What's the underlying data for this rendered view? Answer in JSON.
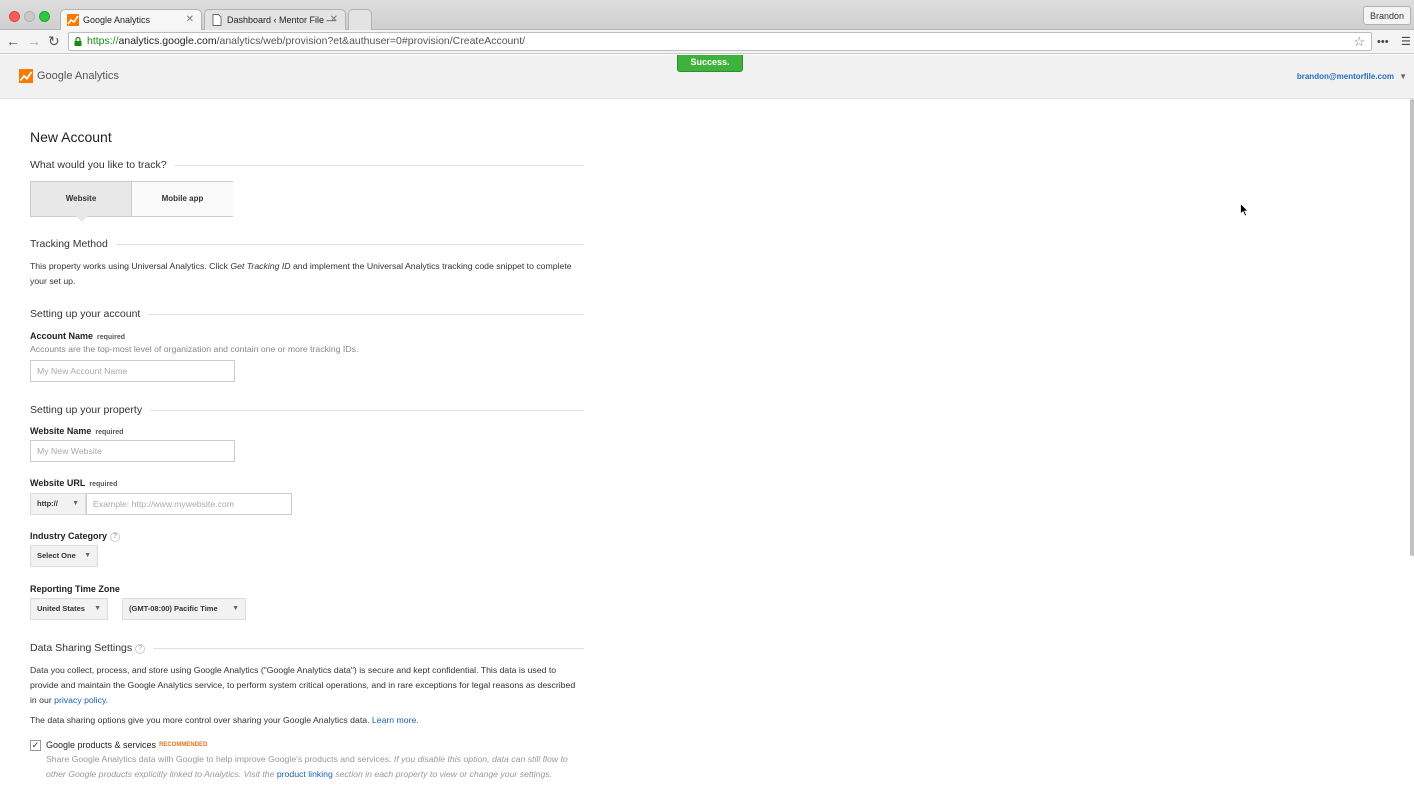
{
  "browser": {
    "tabs": [
      {
        "title": "Google Analytics",
        "active": true
      },
      {
        "title": "Dashboard ‹ Mentor File —",
        "active": false
      }
    ],
    "profile": "Brandon",
    "url_scheme": "https://",
    "url_host": "analytics.google.com",
    "url_path": "/analytics/web/provision?et&authuser=0#provision/CreateAccount/"
  },
  "header": {
    "app_name": "Google Analytics",
    "success_message": "Success.",
    "user_email": "brandon@mentorfile.com"
  },
  "form": {
    "title": "New Account",
    "track_question": "What would you like to track?",
    "track_options": [
      "Website",
      "Mobile app"
    ],
    "tracking_method": {
      "title": "Tracking Method",
      "text_before": "This property works using Universal Analytics. Click ",
      "text_emph": "Get Tracking ID",
      "text_after": " and implement the Universal Analytics tracking code snippet to complete your set up."
    },
    "account_section": "Setting up your account",
    "account_name_label": "Account Name",
    "required": "required",
    "account_name_desc": "Accounts are the top-most level of organization and contain one or more tracking IDs.",
    "account_name_placeholder": "My New Account Name",
    "property_section": "Setting up your property",
    "website_name_label": "Website Name",
    "website_name_placeholder": "My New Website",
    "website_url_label": "Website URL",
    "protocol_value": "http://",
    "website_url_placeholder": "Example: http://www.mywebsite.com",
    "industry_label": "Industry Category",
    "industry_value": "Select One",
    "timezone_label": "Reporting Time Zone",
    "country_value": "United States",
    "timezone_value": "(GMT-08:00) Pacific Time",
    "data_sharing": {
      "title": "Data Sharing Settings",
      "para1": "Data you collect, process, and store using Google Analytics (\"Google Analytics data\") is secure and kept confidential. This data is used to provide and maintain the Google Analytics service, to perform system critical operations, and in rare exceptions for legal reasons as described in our ",
      "privacy_link": "privacy policy",
      "para1_end": ".",
      "para2": "The data sharing options give you more control over sharing your Google Analytics data. ",
      "learn_more": "Learn more.",
      "option_label": "Google products & services",
      "option_badge": "RECOMMENDED",
      "option_desc": "Share Google Analytics data with Google to help improve Google's products and services. ",
      "option_desc_italic": "If you disable this option, data can still flow to other Google products explicitly linked to Analytics. Visit the ",
      "product_linking": "product linking",
      "option_desc_italic_end": " section in each property to view or change your settings.",
      "option_checked": true
    }
  },
  "colors": {
    "success_green": "#3fb23d",
    "link_blue": "#1a5fb4",
    "recommended_orange": "#e8711e"
  }
}
